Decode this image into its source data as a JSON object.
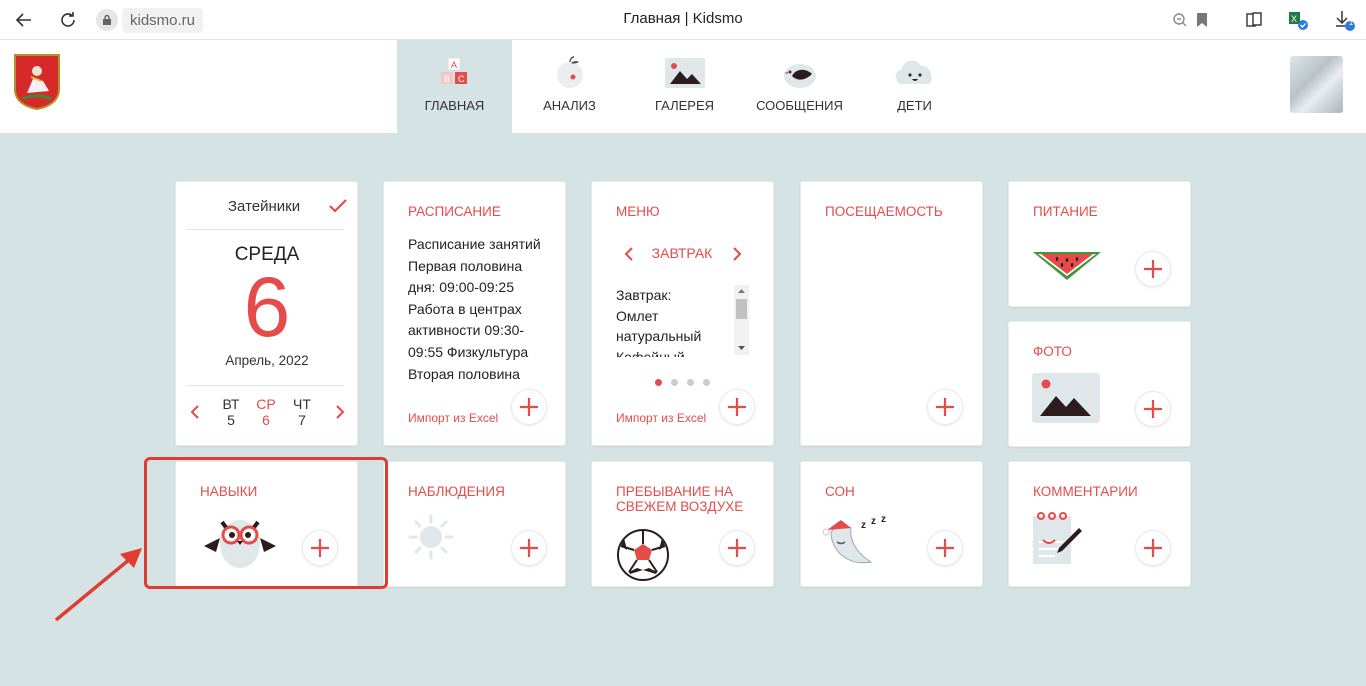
{
  "browser": {
    "url": "kidsmo.ru",
    "tab_title": "Главная | Kidsmo",
    "download_badge": "1"
  },
  "nav": {
    "items": [
      {
        "label": "ГЛАВНАЯ",
        "icon": "abc-blocks-icon",
        "active": true
      },
      {
        "label": "АНАЛИЗ",
        "icon": "apple-icon"
      },
      {
        "label": "ГАЛЕРЕЯ",
        "icon": "picture-icon"
      },
      {
        "label": "СООБЩЕНИЯ",
        "icon": "bird-icon"
      },
      {
        "label": "ДЕТИ",
        "icon": "cloud-icon"
      }
    ]
  },
  "date_card": {
    "group_name": "Затейники",
    "day_of_week": "СРЕДА",
    "day_number": "6",
    "month_year": "Апрель, 2022",
    "week": [
      {
        "abbr": "ВТ",
        "num": "5"
      },
      {
        "abbr": "СР",
        "num": "6",
        "current": true
      },
      {
        "abbr": "ЧТ",
        "num": "7"
      }
    ]
  },
  "schedule": {
    "title": "РАСПИСАНИЕ",
    "text": "Расписание занятий Первая половина дня: 09:00-09:25 Работа в центрах активности 09:30-09:55 Физкультура Вторая половина",
    "import_link": "Импорт из Excel"
  },
  "menu": {
    "title": "МЕНЮ",
    "selected_meal": "ЗАВТРАК",
    "text": "Завтрак: Омлет натуральный Кофейный",
    "import_link": "Импорт из Excel",
    "pages": 4,
    "active_page": 0
  },
  "attendance": {
    "title": "ПОСЕЩАЕМОСТЬ"
  },
  "nutrition": {
    "title": "ПИТАНИЕ",
    "icon": "watermelon-icon"
  },
  "photo": {
    "title": "ФОТО",
    "icon": "photo-icon"
  },
  "skills": {
    "title": "НАВЫКИ",
    "icon": "owl-icon"
  },
  "observations": {
    "title": "НАБЛЮДЕНИЯ",
    "icon": "sun-icon"
  },
  "outdoor": {
    "title": "ПРЕБЫВАНИЕ НА СВЕЖЕМ ВОЗДУХЕ",
    "icon": "soccer-ball-icon"
  },
  "sleep": {
    "title": "СОН",
    "icon": "sleeping-moon-icon"
  },
  "comments": {
    "title": "КОММЕНТАРИИ",
    "icon": "notepad-icon"
  },
  "colors": {
    "accent": "#e64b4b",
    "background": "#d5e3e5",
    "annotation": "#e03c31"
  }
}
